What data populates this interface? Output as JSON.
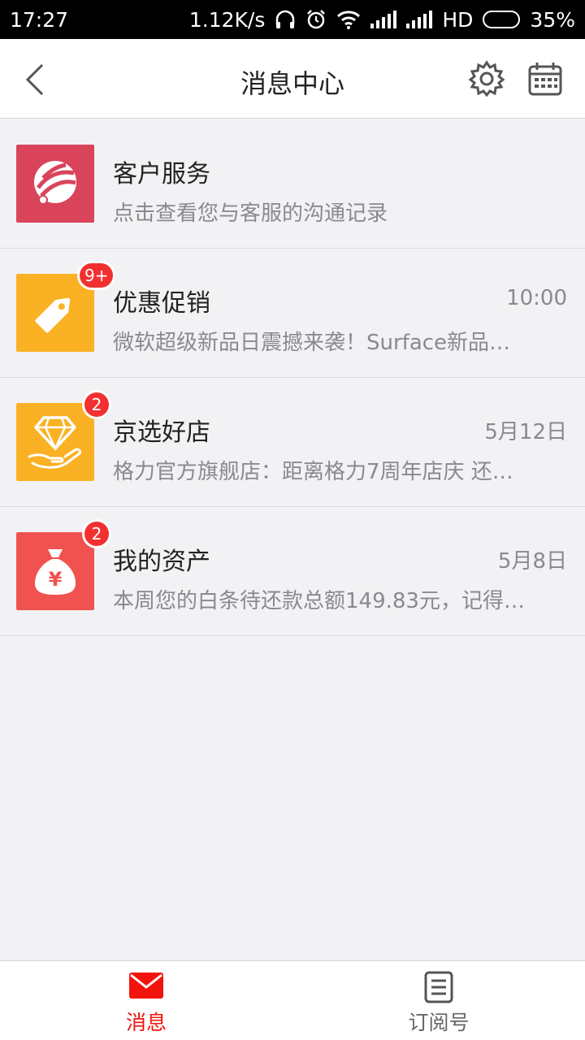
{
  "status_bar": {
    "time": "17:27",
    "net_speed": "1.12K/s",
    "network": "HD",
    "battery": "35%",
    "battery_level": 0.35
  },
  "header": {
    "title": "消息中心",
    "icons": [
      "back-arrow-icon",
      "gear-icon",
      "calendar-icon"
    ]
  },
  "messages": [
    {
      "name": "客户服务",
      "desc": "点击查看您与客服的沟通记录",
      "time": "",
      "badge": "",
      "icon": "customer-service-icon",
      "color": "#d9445a"
    },
    {
      "name": "优惠促销",
      "desc": "微软超级新品日震撼来袭！Surface新品…",
      "time": "10:00",
      "badge": "9+",
      "icon": "tag-icon",
      "color": "#fbb124"
    },
    {
      "name": "京选好店",
      "desc": "格力官方旗舰店：距离格力7周年店庆 还…",
      "time": "5月12日",
      "badge": "2",
      "icon": "diamond-icon",
      "color": "#fbb124"
    },
    {
      "name": "我的资产",
      "desc": "本周您的白条待还款总额149.83元，记得…",
      "time": "5月8日",
      "badge": "2",
      "icon": "money-bag-icon",
      "color": "#f0524f"
    }
  ],
  "tabs": [
    {
      "label": "消息",
      "active": true,
      "icon": "envelope-icon"
    },
    {
      "label": "订阅号",
      "active": false,
      "icon": "document-list-icon"
    }
  ],
  "colors": {
    "accent": "#f2140c",
    "badge": "#f23030"
  }
}
